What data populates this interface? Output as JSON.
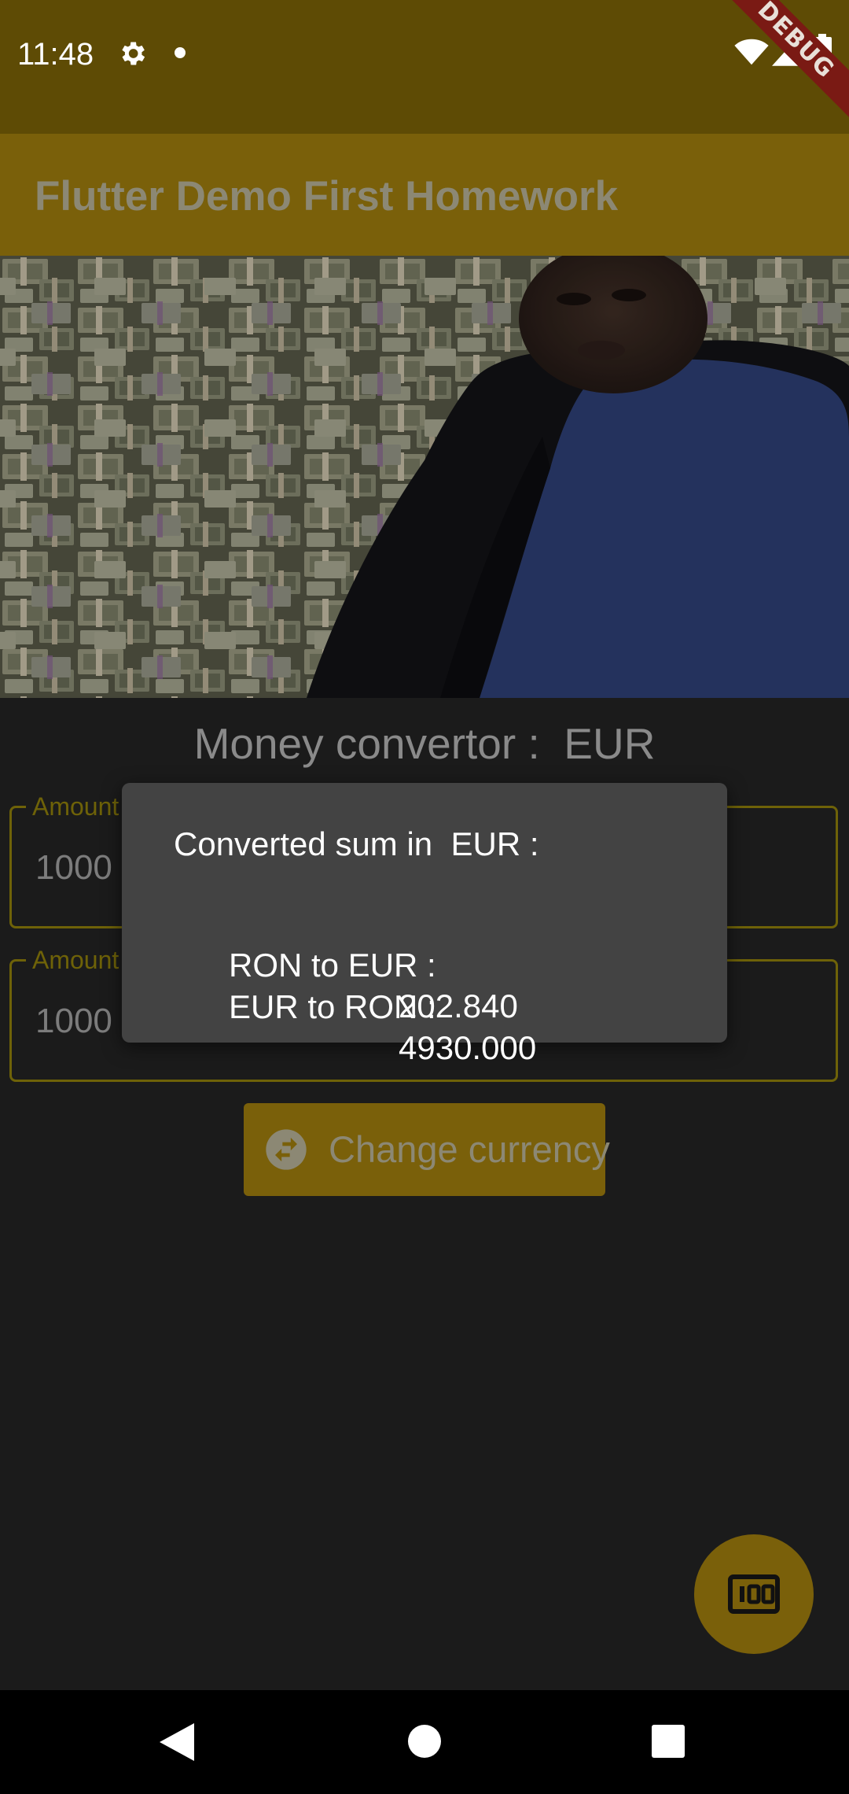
{
  "status_bar": {
    "time": "11:48",
    "icons": [
      "gear-icon",
      "notification-dot-icon",
      "wifi-icon",
      "signal-icon",
      "battery-icon"
    ],
    "debug_banner": "DEBUG"
  },
  "app_bar": {
    "title": "Flutter Demo First Homework"
  },
  "hero_image": {
    "description_icon": "money-pile-photo"
  },
  "converter": {
    "title": "Money convertor :  EUR",
    "fields": [
      {
        "label": "Amount",
        "value": "1000"
      },
      {
        "label": "Amount",
        "value": "1000"
      }
    ],
    "change_button": {
      "label": "Change currency",
      "icon": "swap-horizontal-circle-icon"
    }
  },
  "fab": {
    "icon": "money-icon"
  },
  "dialog": {
    "title": "Converted sum in  EUR :",
    "rows": [
      {
        "label": "RON to EUR :",
        "value": "202.840"
      },
      {
        "label": "EUR to RON :",
        "value": "4930.000"
      }
    ]
  },
  "colors": {
    "status_bar_bg": "#5e4b05",
    "app_bar_bg": "#7a600a",
    "background": "#1b1b1b",
    "dialog_bg": "#434343",
    "field_border": "#6e6208",
    "accent_dimmed": "#7a600a"
  }
}
